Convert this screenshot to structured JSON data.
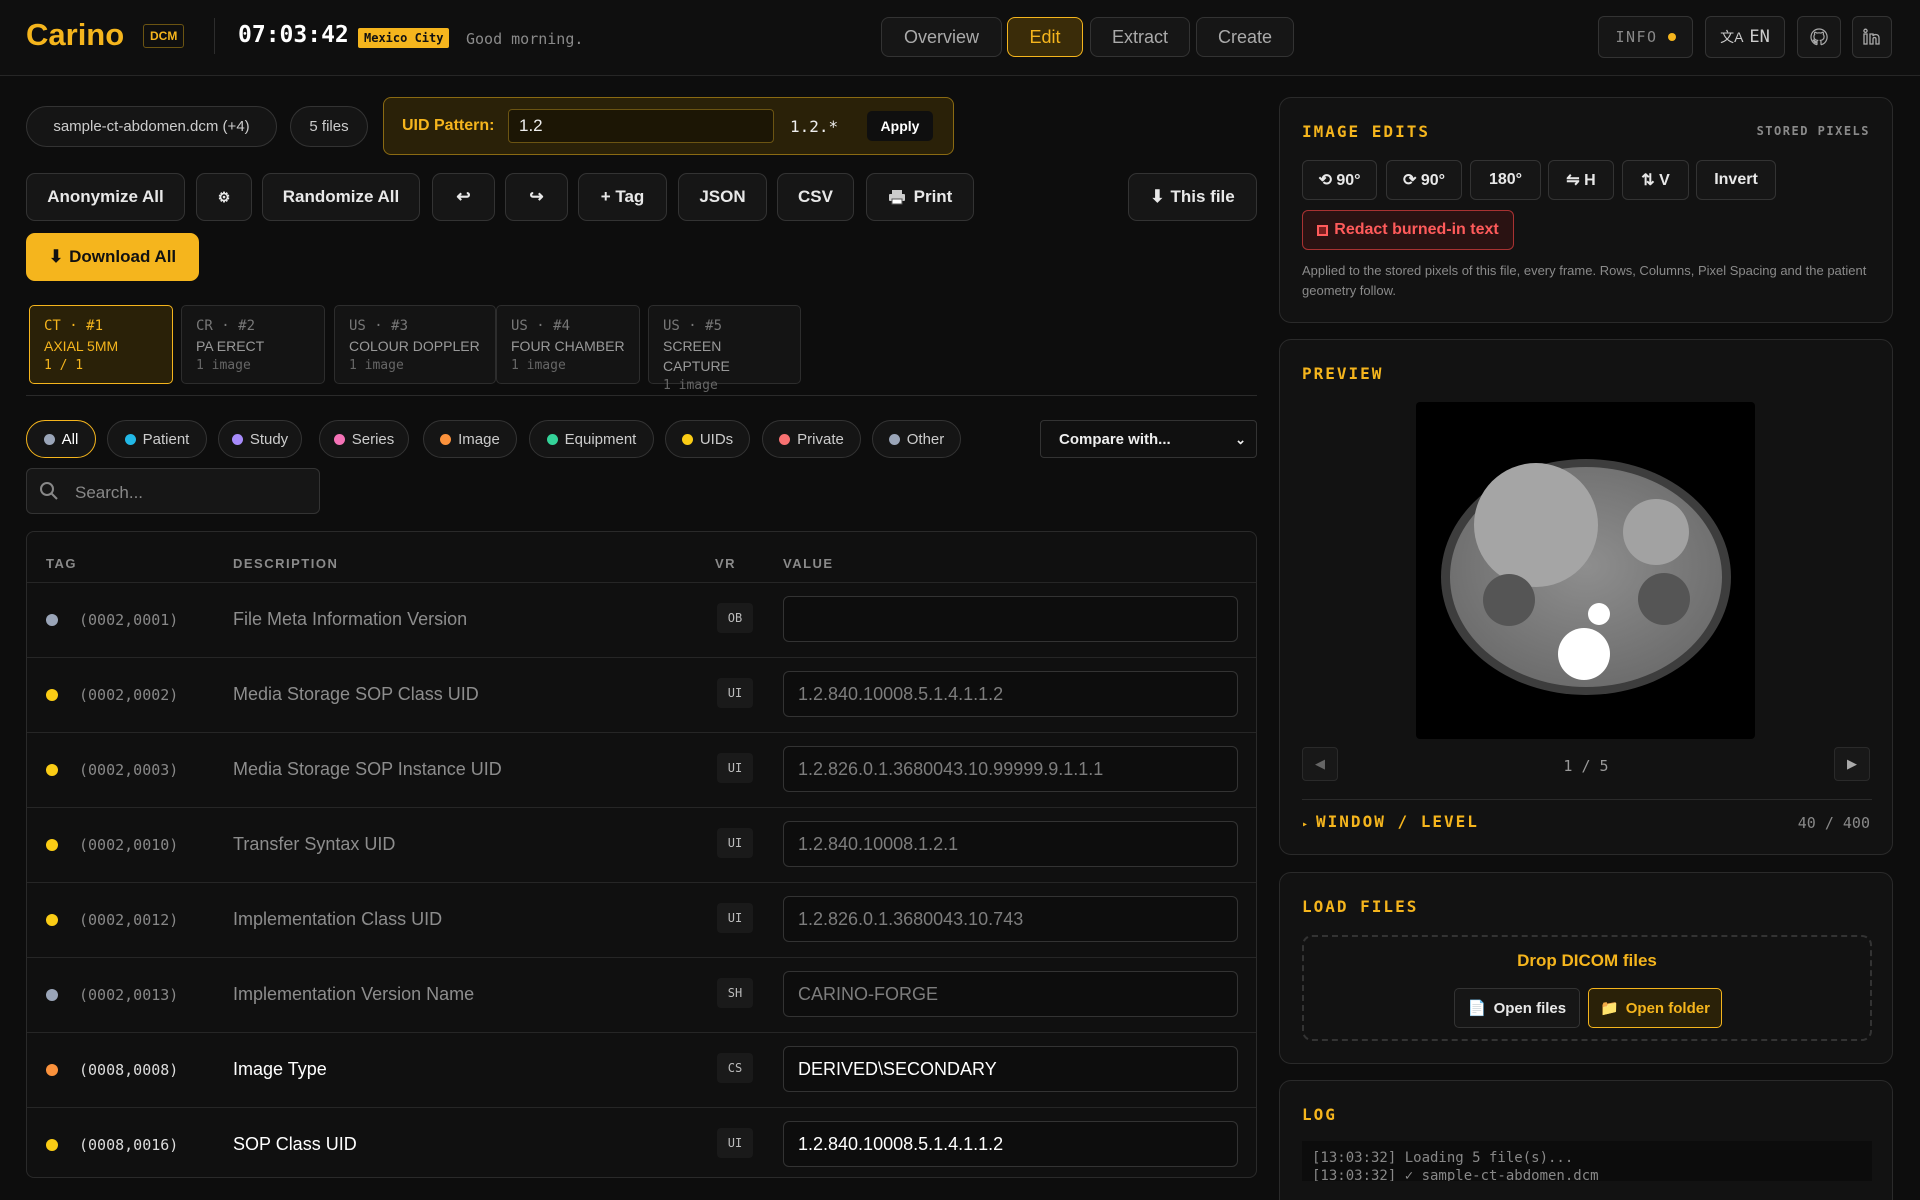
{
  "header": {
    "logo": "Carino",
    "format_badge": "DCM",
    "time": "07:03:42",
    "city": "Mexico City",
    "greeting": "Good morning.",
    "nav": [
      "Overview",
      "Edit",
      "Extract",
      "Create"
    ],
    "nav_active": "Edit",
    "info_label": "INFO",
    "language": "EN"
  },
  "files": {
    "current": "sample-ct-abdomen.dcm (+4)",
    "count": "5 files"
  },
  "uid": {
    "label": "UID Pattern:",
    "value": "1.2",
    "preview": "1.2.*",
    "apply": "Apply"
  },
  "toolbar": {
    "anonymize": "Anonymize All",
    "settings_icon": "⚙",
    "randomize": "Randomize All",
    "undo": "↩",
    "redo": "↪",
    "add_tag": "+ Tag",
    "json": "JSON",
    "csv": "CSV",
    "print": "Print",
    "this_file": "This file",
    "download_all": "Download All"
  },
  "file_tabs": [
    {
      "line1": "CT · #1",
      "line2": "AXIAL 5MM",
      "line3": "1 / 1"
    },
    {
      "line1": "CR · #2",
      "line2": "PA ERECT",
      "line3": "1 image"
    },
    {
      "line1": "US · #3",
      "line2": "COLOUR DOPPLER",
      "line3": "1 image"
    },
    {
      "line1": "US · #4",
      "line2": "FOUR CHAMBER",
      "line3": "1 image"
    },
    {
      "line1": "US · #5",
      "line2": "SCREEN CAPTURE",
      "line3": "1 image"
    }
  ],
  "filters": [
    {
      "label": "All",
      "color": "#9aa5b8"
    },
    {
      "label": "Patient",
      "color": "#22b8e6"
    },
    {
      "label": "Study",
      "color": "#a78bfa"
    },
    {
      "label": "Series",
      "color": "#f472b6"
    },
    {
      "label": "Image",
      "color": "#fb923c"
    },
    {
      "label": "Equipment",
      "color": "#34d399"
    },
    {
      "label": "UIDs",
      "color": "#facc15"
    },
    {
      "label": "Private",
      "color": "#f87171"
    },
    {
      "label": "Other",
      "color": "#9aa5b8"
    }
  ],
  "compare": "Compare with...",
  "search_placeholder": "Search...",
  "table": {
    "headers": [
      "TAG",
      "DESCRIPTION",
      "VR",
      "VALUE"
    ],
    "rows": [
      {
        "tag": "(0002,0001)",
        "desc": "File Meta Information Version",
        "vr": "OB",
        "value": "",
        "color": "#9aa5b8",
        "strong": false
      },
      {
        "tag": "(0002,0002)",
        "desc": "Media Storage SOP Class UID",
        "vr": "UI",
        "value": "1.2.840.10008.5.1.4.1.1.2",
        "color": "#facc15",
        "strong": false
      },
      {
        "tag": "(0002,0003)",
        "desc": "Media Storage SOP Instance UID",
        "vr": "UI",
        "value": "1.2.826.0.1.3680043.10.99999.9.1.1.1",
        "color": "#facc15",
        "strong": false
      },
      {
        "tag": "(0002,0010)",
        "desc": "Transfer Syntax UID",
        "vr": "UI",
        "value": "1.2.840.10008.1.2.1",
        "color": "#facc15",
        "strong": false
      },
      {
        "tag": "(0002,0012)",
        "desc": "Implementation Class UID",
        "vr": "UI",
        "value": "1.2.826.0.1.3680043.10.743",
        "color": "#facc15",
        "strong": false
      },
      {
        "tag": "(0002,0013)",
        "desc": "Implementation Version Name",
        "vr": "SH",
        "value": "CARINO-FORGE",
        "color": "#9aa5b8",
        "strong": false
      },
      {
        "tag": "(0008,0008)",
        "desc": "Image Type",
        "vr": "CS",
        "value": "DERIVED\\SECONDARY",
        "color": "#fb923c",
        "strong": true
      },
      {
        "tag": "(0008,0016)",
        "desc": "SOP Class UID",
        "vr": "UI",
        "value": "1.2.840.10008.5.1.4.1.1.2",
        "color": "#facc15",
        "strong": true
      }
    ]
  },
  "image_edits": {
    "title": "IMAGE EDITS",
    "subtitle": "STORED PIXELS",
    "buttons": [
      "⟲ 90°",
      "⟳ 90°",
      "180°",
      "⇋ H",
      "⇅ V",
      "Invert"
    ],
    "redact": "Redact burned-in text",
    "note": "Applied to the stored pixels of this file, every frame. Rows, Columns, Pixel Spacing and the patient geometry follow."
  },
  "preview": {
    "title": "PREVIEW",
    "counter": "1 / 5",
    "window_level_label": "WINDOW / LEVEL",
    "window_level_value": "40 / 400"
  },
  "load": {
    "title": "LOAD FILES",
    "drop": "Drop DICOM files",
    "open_files": "Open files",
    "open_folder": "Open folder"
  },
  "log": {
    "title": "LOG",
    "lines": [
      "[13:03:32] Loading 5 file(s)...",
      "[13:03:32] ✓ sample-ct-abdomen.dcm"
    ]
  },
  "colors": {
    "accent": "#f5b51d",
    "background": "#0d0d0d",
    "danger": "#ff5b5b"
  }
}
